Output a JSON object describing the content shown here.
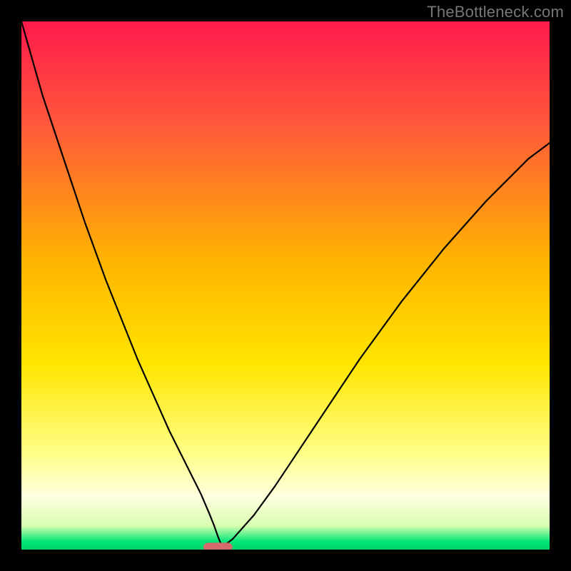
{
  "watermark": "TheBottleneck.com",
  "chart_data": {
    "type": "line",
    "title": "",
    "xlabel": "",
    "ylabel": "",
    "xlim": [
      0,
      100
    ],
    "ylim": [
      0,
      100
    ],
    "grid": false,
    "legend": false,
    "background_gradient_stops": [
      {
        "offset": 0.0,
        "color": "#ff1a4b"
      },
      {
        "offset": 0.2,
        "color": "#ff5a3a"
      },
      {
        "offset": 0.45,
        "color": "#ffb300"
      },
      {
        "offset": 0.65,
        "color": "#ffe600"
      },
      {
        "offset": 0.82,
        "color": "#ffff8a"
      },
      {
        "offset": 0.9,
        "color": "#ffffe0"
      },
      {
        "offset": 0.955,
        "color": "#d8ffb0"
      },
      {
        "offset": 0.985,
        "color": "#00e676"
      },
      {
        "offset": 1.0,
        "color": "#00d166"
      }
    ],
    "series": [
      {
        "name": "bottleneck-curve",
        "stroke": "#000000",
        "stroke_width": 2.2,
        "x": [
          0,
          2,
          4,
          6,
          8,
          10,
          12,
          14,
          16,
          18,
          20,
          22,
          24,
          26,
          28,
          30,
          32,
          34,
          35.5,
          36.5,
          37.2,
          38,
          40,
          44,
          48,
          52,
          56,
          60,
          64,
          68,
          72,
          76,
          80,
          84,
          88,
          92,
          96,
          100
        ],
        "y": [
          100,
          93,
          86,
          80,
          74,
          68,
          62,
          56.5,
          51,
          46,
          41,
          36,
          31.5,
          27,
          22.5,
          18.5,
          14.5,
          10.5,
          7,
          4.5,
          2.5,
          0.5,
          2,
          6.5,
          12,
          18,
          24,
          30,
          36,
          41.5,
          47,
          52,
          57,
          61.5,
          66,
          70,
          74,
          77
        ]
      }
    ],
    "marker": {
      "name": "bottleneck-marker",
      "x_center": 37.2,
      "y": 0.5,
      "width": 5.5,
      "height": 1.6,
      "rx": 1.0,
      "fill": "#d46a6a"
    }
  }
}
